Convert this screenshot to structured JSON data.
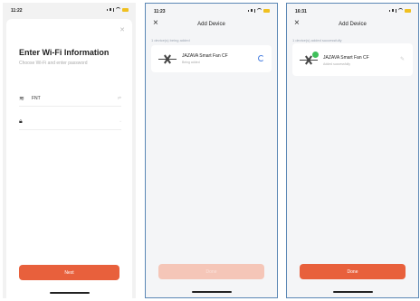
{
  "screen1": {
    "time": "11:22",
    "title": "Enter Wi-Fi Information",
    "subtitle": "Choose Wi-Fi and enter password",
    "wifi_name": "FNT",
    "password_value": "",
    "next_label": "Next"
  },
  "screen2": {
    "time": "11:23",
    "title": "Add Device",
    "note": "1 device(s) being added",
    "device_name": "JAZAVA Smart Fan CF",
    "device_status": "Being added",
    "done_label": "Done"
  },
  "screen3": {
    "time": "16:31",
    "title": "Add Device",
    "note": "1 device(s) added successfully",
    "device_name": "JAZAVA Smart Fan CF",
    "device_status": "Added successfully",
    "done_label": "Done"
  },
  "colors": {
    "accent": "#e8603c",
    "accent_disabled": "#f5c6b8",
    "success": "#3fbf5a",
    "spinner": "#4a7fe0"
  }
}
